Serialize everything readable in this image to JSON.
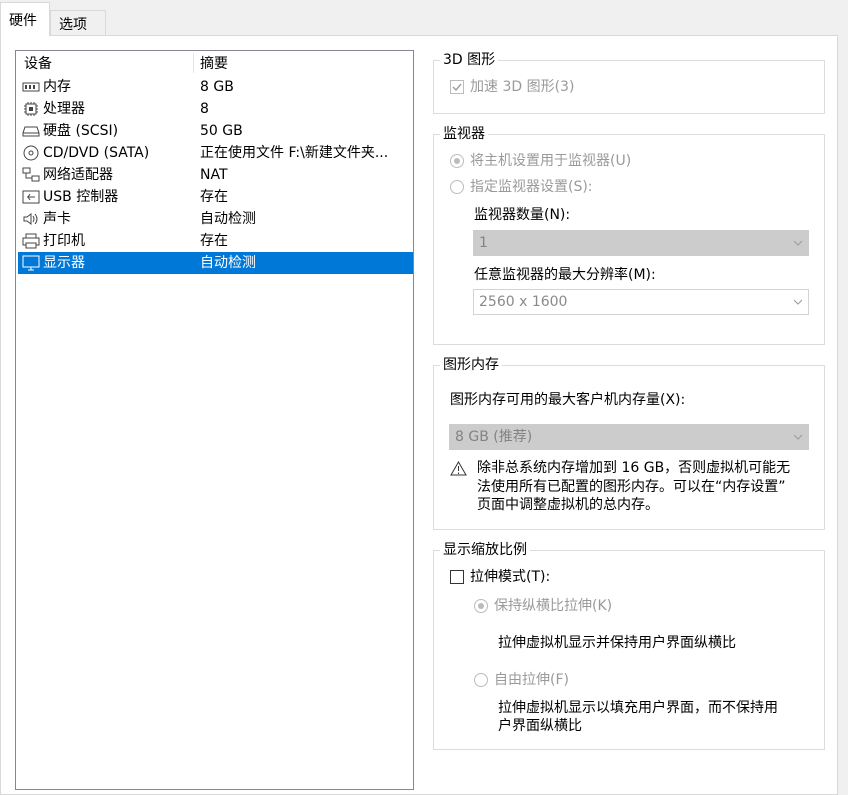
{
  "tabs": [
    {
      "label": "硬件"
    },
    {
      "label": "选项"
    }
  ],
  "devices": {
    "header": {
      "device": "设备",
      "summary": "摘要"
    },
    "items": [
      {
        "icon": "memory-icon",
        "name": "内存",
        "summary": "8 GB"
      },
      {
        "icon": "processor-icon",
        "name": "处理器",
        "summary": "8"
      },
      {
        "icon": "harddisk-icon",
        "name": "硬盘 (SCSI)",
        "summary": "50 GB"
      },
      {
        "icon": "cd-dvd-icon",
        "name": "CD/DVD (SATA)",
        "summary": "正在使用文件 F:\\新建文件夹..."
      },
      {
        "icon": "network-adapter-icon",
        "name": "网络适配器",
        "summary": "NAT"
      },
      {
        "icon": "usb-icon",
        "name": "USB 控制器",
        "summary": "存在"
      },
      {
        "icon": "sound-card-icon",
        "name": "声卡",
        "summary": "自动检测"
      },
      {
        "icon": "printer-icon",
        "name": "打印机",
        "summary": "存在"
      },
      {
        "icon": "display-icon",
        "name": "显示器",
        "summary": "自动检测",
        "selected": true
      }
    ]
  },
  "graphics3d": {
    "title": "3D 图形",
    "accelerate_label": "加速 3D 图形(3)",
    "accelerate_checked": true
  },
  "monitor": {
    "title": "监视器",
    "use_host_label": "将主机设置用于监视器(U)",
    "specify_label": "指定监视器设置(S):",
    "count_label": "监视器数量(N):",
    "count_value": "1",
    "max_res_label": "任意监视器的最大分辨率(M):",
    "max_res_value": "2560 x 1600"
  },
  "graphics_memory": {
    "title": "图形内存",
    "max_label": "图形内存可用的最大客户机内存量(X):",
    "max_value": "8 GB (推荐)",
    "warning_line1": "除非总系统内存增加到 16 GB，否则虚拟机可能无",
    "warning_line2": "法使用所有已配置的图形内存。可以在“内存设置”",
    "warning_line3": "页面中调整虚拟机的总内存。"
  },
  "scaling": {
    "title": "显示缩放比例",
    "stretch_label": "拉伸模式(T):",
    "stretch_checked": false,
    "keep_aspect_label": "保持纵横比拉伸(K)",
    "keep_aspect_desc": "拉伸虚拟机显示并保持用户界面纵横比",
    "free_label": "自由拉伸(F)",
    "free_desc_line1": "拉伸虚拟机显示以填充用户界面，而不保持用",
    "free_desc_line2": "户界面纵横比"
  },
  "colors": {
    "selection": "#0078d7",
    "disabled_text": "#9a9a9a"
  }
}
